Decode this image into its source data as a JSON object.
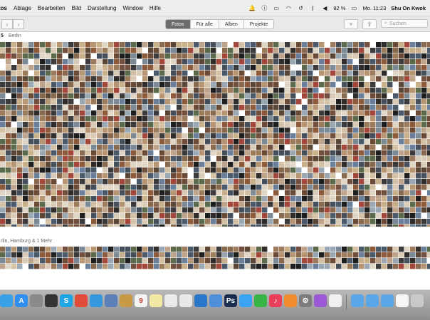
{
  "menubar": {
    "app_fragment": "tos",
    "items": [
      "Ablage",
      "Bearbeiten",
      "Bild",
      "Darstellung",
      "Window",
      "Hilfe"
    ],
    "battery": "82 %",
    "clock": "Mo. 11:23",
    "user": "Shu On Kwok"
  },
  "toolbar": {
    "tabs": [
      "Fotos",
      "Für alle",
      "Alben",
      "Projekte"
    ],
    "active_tab": "Fotos",
    "add_label": "+",
    "search_placeholder": "Suchen"
  },
  "sections": [
    {
      "year_fragment": "5",
      "place": "Berlin"
    },
    {
      "place": "rlin, Hamburg & 1 Mehr"
    }
  ],
  "dock": {
    "icons": [
      {
        "name": "finder",
        "color": "#3aa0e8",
        "glyph": ""
      },
      {
        "name": "appstore",
        "color": "#2f8ef0",
        "glyph": "A"
      },
      {
        "name": "launchpad",
        "color": "#8a8a8a",
        "glyph": ""
      },
      {
        "name": "mission-control",
        "color": "#333333",
        "glyph": ""
      },
      {
        "name": "skype",
        "color": "#1ea5e6",
        "glyph": "S"
      },
      {
        "name": "chrome",
        "color": "#e04b3a",
        "glyph": ""
      },
      {
        "name": "safari",
        "color": "#3598dc",
        "glyph": ""
      },
      {
        "name": "preview",
        "color": "#5b7fb6",
        "glyph": ""
      },
      {
        "name": "notes",
        "color": "#c79a45",
        "glyph": ""
      },
      {
        "name": "calendar",
        "color": "#f4f4f4",
        "glyph": "9"
      },
      {
        "name": "stickies",
        "color": "#f1e9a3",
        "glyph": ""
      },
      {
        "name": "textedit",
        "color": "#eaeaea",
        "glyph": ""
      },
      {
        "name": "photos",
        "color": "#e8e8e8",
        "glyph": ""
      },
      {
        "name": "keynote",
        "color": "#2a76c9",
        "glyph": ""
      },
      {
        "name": "mail",
        "color": "#4f8fd9",
        "glyph": ""
      },
      {
        "name": "photoshop",
        "color": "#1b2e4f",
        "glyph": "Ps"
      },
      {
        "name": "messages",
        "color": "#3ba4f2",
        "glyph": ""
      },
      {
        "name": "facetime",
        "color": "#39b548",
        "glyph": ""
      },
      {
        "name": "itunes",
        "color": "#ea3f5a",
        "glyph": "♪"
      },
      {
        "name": "ibooks",
        "color": "#f08c2e",
        "glyph": ""
      },
      {
        "name": "system-preferences",
        "color": "#7d7d7d",
        "glyph": "⚙"
      },
      {
        "name": "itunes-connect",
        "color": "#9b59d6",
        "glyph": ""
      },
      {
        "name": "document",
        "color": "#f0f0f0",
        "glyph": ""
      },
      {
        "name": "applications-folder",
        "color": "#5aa6e6",
        "glyph": ""
      },
      {
        "name": "documents-folder",
        "color": "#5aa6e6",
        "glyph": ""
      },
      {
        "name": "downloads-folder",
        "color": "#5aa6e6",
        "glyph": ""
      },
      {
        "name": "file",
        "color": "#f6f6f6",
        "glyph": ""
      },
      {
        "name": "trash",
        "color": "#c9c9c9",
        "glyph": ""
      }
    ]
  }
}
